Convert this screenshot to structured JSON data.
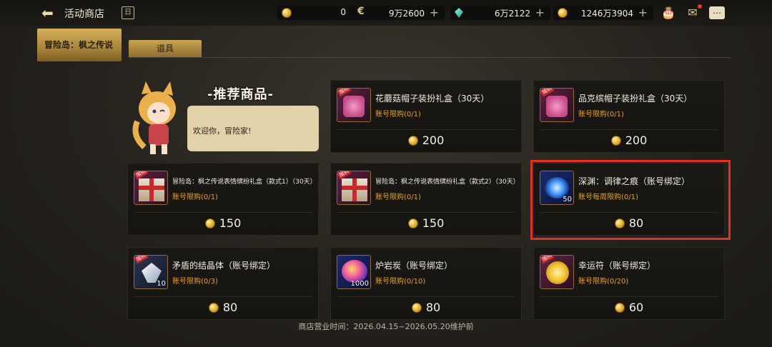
{
  "topbar": {
    "title": "活动商店",
    "currencies": [
      {
        "icon": "gold-coin-icon",
        "value": "0"
      },
      {
        "icon": "c-coin-icon",
        "value": "9万2600"
      },
      {
        "icon": "gem-icon",
        "value": "6万2122"
      },
      {
        "icon": "gold-coin-icon",
        "value": "1246万3904"
      }
    ],
    "plus": "+"
  },
  "sidebar": {
    "active_tab": "冒险岛：枫之传说"
  },
  "subtabs": [
    {
      "label": "道具"
    }
  ],
  "recommend": {
    "title": "-推荐商品-",
    "greeting": "欢迎你，冒险家!"
  },
  "badge_text": "限购",
  "items": [
    {
      "name": "花蘑菇帽子装扮礼盒（30天）",
      "limit": "账号限购(0/1)",
      "price": "200",
      "art": "hat-box"
    },
    {
      "name": "品克缤帽子装扮礼盒（30天）",
      "limit": "账号限购(0/1)",
      "price": "200",
      "art": "hat-box"
    },
    {
      "name": "冒险岛：枫之传说表情缤纷礼盒（款式1）（30天）",
      "limit": "账号限购(0/1)",
      "price": "150",
      "art": "gift-box"
    },
    {
      "name": "冒险岛：枫之传说表情缤纷礼盒（款式2）（30天）",
      "limit": "账号限购(0/1)",
      "price": "150",
      "art": "gift-box"
    },
    {
      "name": "深渊：调律之痕（账号绑定）",
      "limit": "账号每周限购(0/1)",
      "price": "80",
      "qty": "50",
      "art": "blue-orb"
    },
    {
      "name": "矛盾的结晶体（账号绑定）",
      "limit": "账号限购(0/3)",
      "price": "80",
      "qty": "10",
      "art": "crystal"
    },
    {
      "name": "炉岩炭（账号绑定）",
      "limit": "账号限购(0/10)",
      "price": "80",
      "qty": "1000",
      "art": "lava-coal"
    },
    {
      "name": "幸运符（账号绑定）",
      "limit": "账号限购(0/20)",
      "price": "60",
      "art": "lucky-charm"
    }
  ],
  "footer": "商店营业时间：2026.04.15~2026.05.20维护前",
  "colors": {
    "accent_gold": "#d4b05a",
    "limit_text": "#e2a03a",
    "highlight": "#e03124"
  }
}
